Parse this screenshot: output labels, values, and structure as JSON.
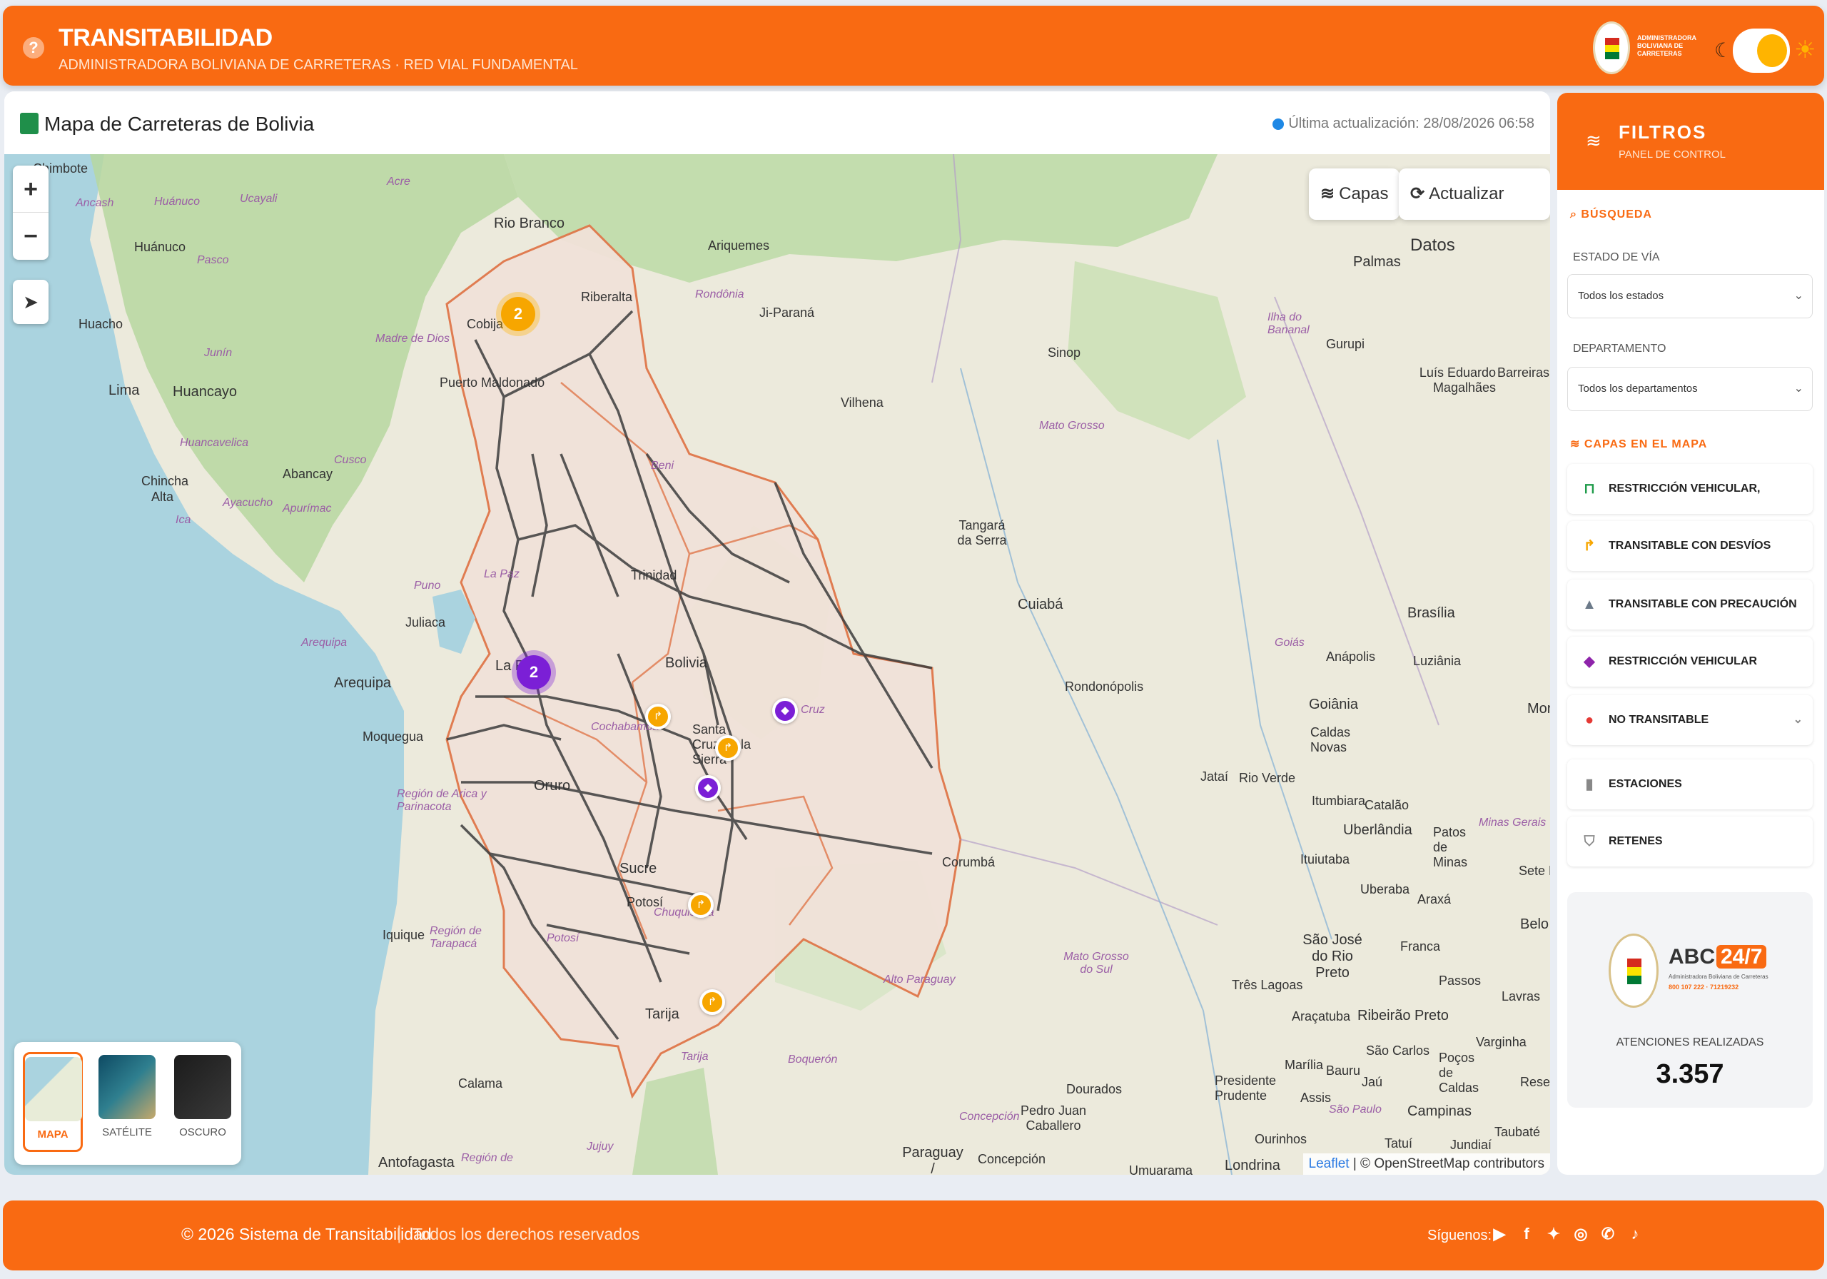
{
  "header": {
    "title": "TRANSITABILIDAD",
    "subtitle": "ADMINISTRADORA BOLIVIANA DE CARRETERAS · RED VIAL FUNDAMENTAL",
    "help_icon": "?",
    "logo_text": "ADMINISTRADORA BOLIVIANA DE CARRETERAS",
    "theme_toggle": "light"
  },
  "map_panel": {
    "title": "Mapa de Carreteras de Bolivia",
    "last_update": "Última actualización: 28/08/2026 06:58",
    "layers_button": "Capas",
    "refresh_button": "Actualizar Datos",
    "zoom_in": "+",
    "zoom_out": "−",
    "attribution_leaflet": "Leaflet",
    "attribution_rest": "| © OpenStreetMap contributors",
    "basemaps": [
      {
        "label": "MAPA",
        "active": true
      },
      {
        "label": "SATÉLITE",
        "active": false
      },
      {
        "label": "OSCURO",
        "active": false
      }
    ],
    "clusters": [
      {
        "count": "2",
        "color": "#f7a600"
      },
      {
        "count": "2",
        "color": "#7b1fd6"
      }
    ],
    "labels": {
      "chimbote": "Chimbote",
      "ancash": "Ancash",
      "huanuco_r": "Huánuco",
      "huanuco": "Huánuco",
      "ucayali": "Ucayali",
      "acre": "Acre",
      "pasco": "Pasco",
      "huacho": "Huacho",
      "junin": "Junín",
      "lima": "Lima",
      "huancayo": "Huancayo",
      "huancavelica": "Huancavelica",
      "chincha": "Chincha",
      "alta": "Alta",
      "ica_r": "Ica",
      "ayacucho": "Ayacucho",
      "abancay": "Abancay",
      "apurimac": "Apurímac",
      "cusco": "Cusco",
      "madre_de_dios": "Madre de Dios",
      "puerto_maldonado": "Puerto Maldonado",
      "cobija": "Cobija",
      "rio_branco": "Rio Branco",
      "riberalta": "Riberalta",
      "ariquemes": "Ariquemes",
      "rondonia": "Rondônia",
      "ji_parana": "Ji-Paraná",
      "vilhena": "Vilhena",
      "sinop": "Sinop",
      "mato_grosso": "Mato Grosso",
      "palmas": "Palmas",
      "ilha": "Ilha do Bananal",
      "gurupi": "Gurupi",
      "luis": "Luís Eduardo Magalhães",
      "barreiras": "Barreiras",
      "tangara": "Tangará da Serra",
      "beni": "Beni",
      "trinidad": "Trinidad",
      "la_paz_r": "La Paz",
      "puno": "Puno",
      "juliaca": "Juliaca",
      "arequipa_r": "Arequipa",
      "arequipa": "Arequipa",
      "moquegua": "Moquegua",
      "la_paz": "La Paz",
      "bolivia": "Bolivia",
      "cochabamba": "Cochabamba",
      "santa_cruz": "Santa Cruz de la Sierra",
      "cruz": "Cruz",
      "cuiaba": "Cuiabá",
      "rondonopolis": "Rondonópolis",
      "goias": "Goiás",
      "brasilia": "Brasília",
      "anapolis": "Anápolis",
      "luziania": "Luziânia",
      "goiania": "Goiânia",
      "caldas": "Caldas Novas",
      "mor": "Mor",
      "arica": "Región de Arica y Parinacota",
      "oruro": "Oruro",
      "jatai": "Jataí",
      "rio_verde": "Rio Verde",
      "itumbiara": "Itumbiara",
      "catalao": "Catalão",
      "uberlandia": "Uberlândia",
      "patos": "Patos de Minas",
      "minas": "Minas Gerais",
      "sete": "Sete L",
      "ituiutaba": "Ituiutaba",
      "uberaba": "Uberaba",
      "araxa": "Araxá",
      "corumba": "Corumbá",
      "sucre": "Sucre",
      "potosi": "Potosí",
      "potosi_r": "Potosí",
      "chuquisaca": "Chuquisaca",
      "iquique": "Iquique",
      "tarapaca": "Región de Tarapacá",
      "belo": "Belo",
      "sao_jose": "São José do Rio Preto",
      "franca": "Franca",
      "passos": "Passos",
      "lavras": "Lavras",
      "mato_grosso_sul": "Mato Grosso do Sul",
      "alto_paraguay": "Alto Paraguay",
      "tres_lagoas": "Três Lagoas",
      "aracatuba": "Araçatuba",
      "ribeirao": "Ribeirão Preto",
      "varginha": "Varginha",
      "tarija": "Tarija",
      "tarija_r": "Tarija",
      "boqueron": "Boquerón",
      "sao_carlos": "São Carlos",
      "pocos": "Poços de Caldas",
      "marilia": "Marília",
      "bauru": "Bauru",
      "jau": "Jaú",
      "resen": "Resen",
      "presidente": "Presidente Prudente",
      "assis": "Assis",
      "calama": "Calama",
      "dourados": "Dourados",
      "sao_paulo": "São Paulo",
      "campinas": "Campinas",
      "concepcion_r": "Concepción",
      "pedro": "Pedro Juan Caballero",
      "ourinhos": "Ourinhos",
      "tatui": "Tatuí",
      "jundiai": "Jundiaí",
      "taubate": "Taubaté",
      "jujuy": "Jujuy",
      "antofagasta": "Antofagasta",
      "region_de": "Región de",
      "paraguay": "Paraguay / Paraguái",
      "concepcion": "Concepción",
      "londrina": "Londrina",
      "umuarama": "Umuarama"
    }
  },
  "sidebar": {
    "title": "FILTROS",
    "subtitle": "PANEL DE CONTROL",
    "search_label": "BÚSQUEDA",
    "state_label": "ESTADO DE VÍA",
    "state_value": "Todos los estados",
    "dept_label": "DEPARTAMENTO",
    "dept_value": "Todos los departamentos",
    "layers_label": "CAPAS EN EL MAPA",
    "layers": [
      {
        "label": "RESTRICCIÓN VEHICULAR, ESPECIAL",
        "icon": "barrier-icon",
        "color": "#1e9b4a"
      },
      {
        "label": "TRANSITABLE CON DESVÍOS",
        "icon": "detour-icon",
        "color": "#f7a600"
      },
      {
        "label": "TRANSITABLE CON PRECAUCIÓN",
        "icon": "warning-icon",
        "color": "#6c7a89"
      },
      {
        "label": "RESTRICCIÓN VEHICULAR",
        "icon": "car-icon",
        "color": "#8e24aa"
      },
      {
        "label": "NO TRANSITABLE",
        "icon": "stop-icon",
        "color": "#e53935"
      },
      {
        "label": "ESTACIONES",
        "icon": "fuel-icon",
        "color": "#888888"
      },
      {
        "label": "RETENES",
        "icon": "shield-icon",
        "color": "#888888"
      }
    ],
    "abc": {
      "brand": "ABC",
      "badge": "24/7",
      "subtitle": "Administradora Boliviana de Carreteras",
      "phones": "800 107 222 · 71219232",
      "attentions_label": "ATENCIONES REALIZADAS",
      "attentions_value": "3.357"
    }
  },
  "footer": {
    "copyright": "© 2026 Sistema de Transitabilidad",
    "separator": "|",
    "rights": "Todos los derechos reservados",
    "follow": "Síguenos:",
    "social": [
      "youtube-icon",
      "facebook-icon",
      "twitter-icon",
      "instagram-icon",
      "whatsapp-icon",
      "tiktok-icon"
    ]
  }
}
